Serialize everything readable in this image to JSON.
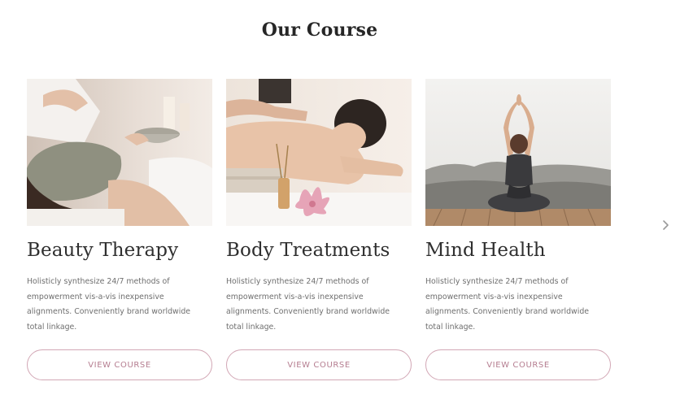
{
  "section": {
    "title": "Our Course"
  },
  "courses": [
    {
      "title": "Beauty Therapy",
      "description": "Holisticly synthesize 24/7 methods of empowerment vis-a-vis inexpensive alignments. Conveniently brand worldwide total linkage.",
      "button_label": "VIEW COURSE",
      "image_icon": "facial-mask-photo"
    },
    {
      "title": "Body Treatments",
      "description": "Holisticly synthesize 24/7 methods of empowerment vis-a-vis inexpensive alignments. Conveniently brand worldwide total linkage.",
      "button_label": "VIEW COURSE",
      "image_icon": "massage-photo"
    },
    {
      "title": "Mind Health",
      "description": "Holisticly synthesize 24/7 methods of empowerment vis-a-vis inexpensive alignments. Conveniently brand worldwide total linkage.",
      "button_label": "VIEW COURSE",
      "image_icon": "yoga-photo"
    }
  ],
  "carousel": {
    "next_icon": "chevron-right-icon"
  },
  "colors": {
    "accent": "#b57d90",
    "button_border": "#d2a7b5",
    "title_text": "#2f2f2f",
    "body_text": "#6f6f6f"
  }
}
